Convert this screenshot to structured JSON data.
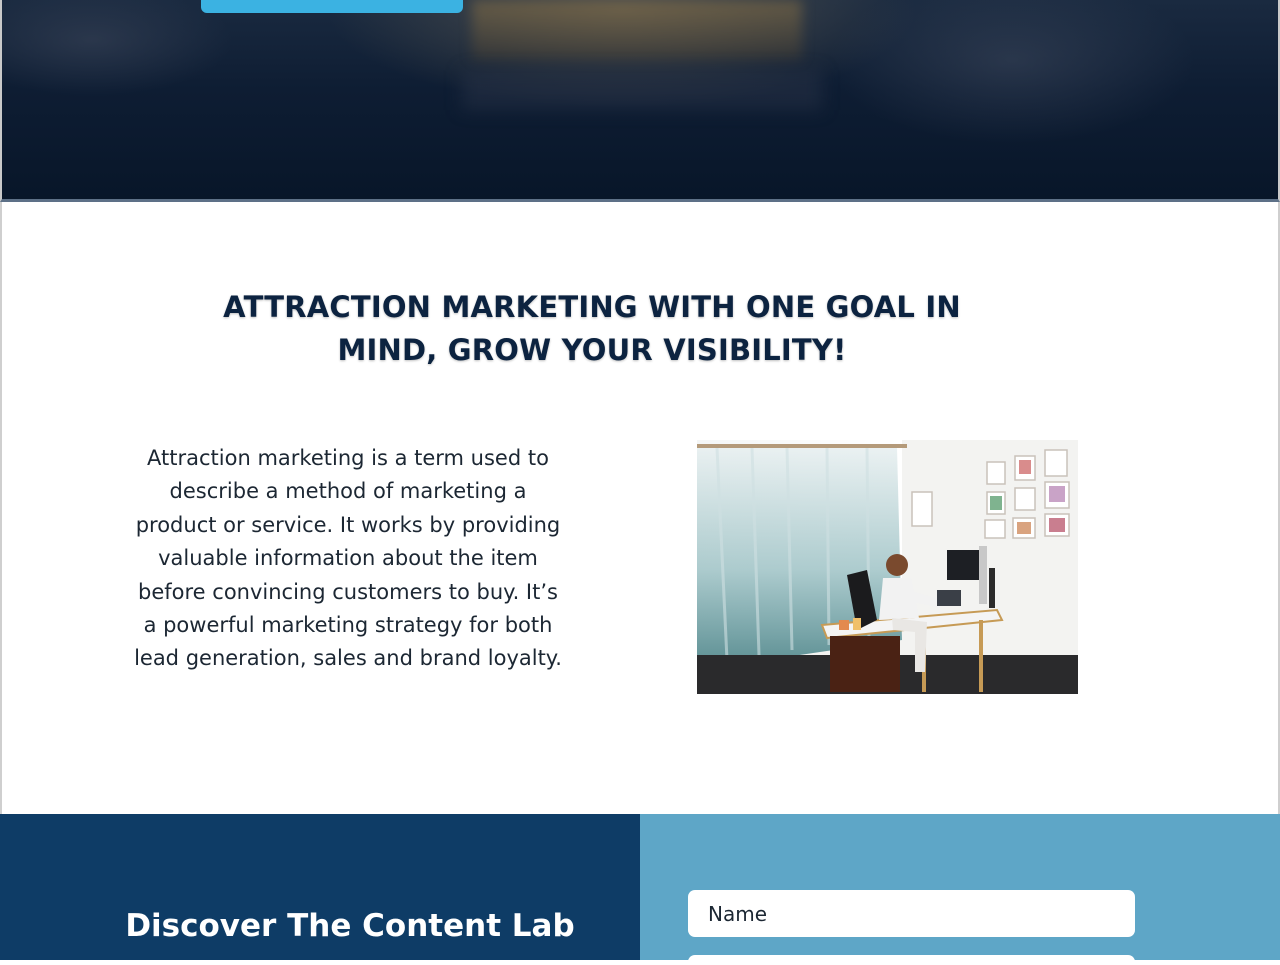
{
  "hero": {
    "cta_label": ""
  },
  "main": {
    "headline": "ATTRACTION MARKETING WITH ONE GOAL IN MIND, GROW YOUR VISIBILITY!",
    "body": "Attraction marketing is a term used to describe a method of marketing a product or service. It works by providing valuable information about the item before convincing customers to buy. It’s a powerful marketing strategy for both lead generation, sales and brand loyalty."
  },
  "signup": {
    "title": "Discover The Content Lab",
    "name_placeholder": "Name"
  },
  "colors": {
    "hero_bg": "#0e1d33",
    "cta_blue": "#3bb2e2",
    "headline": "#0c2340",
    "bottom_left": "#0e3c66",
    "bottom_right": "#5ea6c7"
  }
}
